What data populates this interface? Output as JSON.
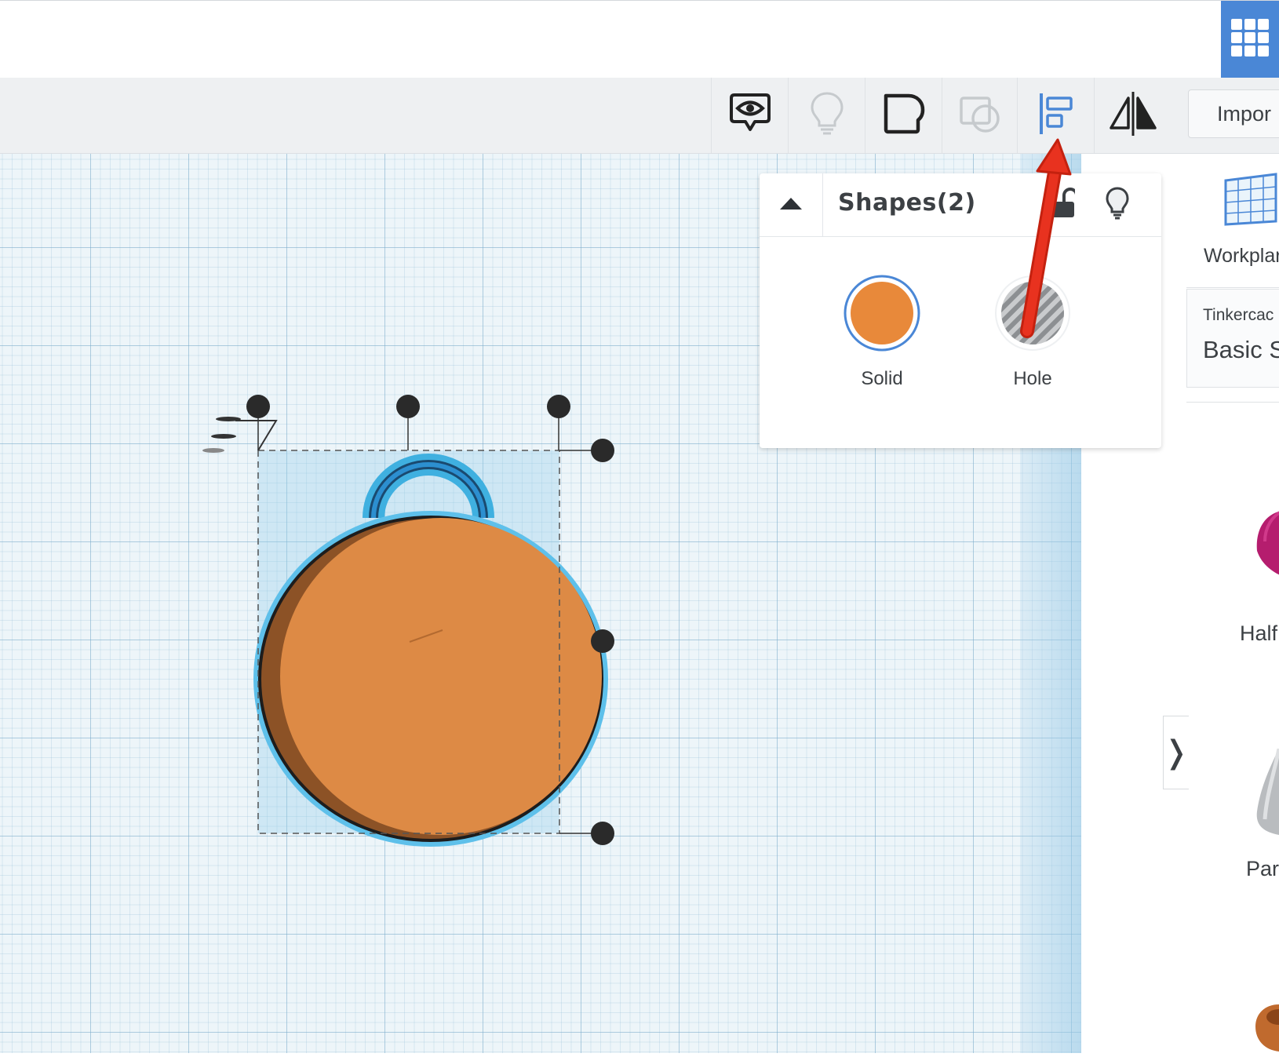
{
  "header": {
    "grid_view_icon": "grid-icon"
  },
  "toolbar": {
    "tools": [
      {
        "name": "notes",
        "icon": "eye-bubble-icon"
      },
      {
        "name": "show-all",
        "icon": "lightbulb-icon"
      },
      {
        "name": "group",
        "icon": "group-shape-icon"
      },
      {
        "name": "ungroup",
        "icon": "ungroup-shape-icon"
      },
      {
        "name": "align",
        "icon": "align-icon"
      },
      {
        "name": "mirror",
        "icon": "mirror-icon"
      }
    ],
    "import_label": "Impor"
  },
  "inspector": {
    "title": "Shapes(2)",
    "solid_label": "Solid",
    "hole_label": "Hole",
    "solid_color": "#e8893a"
  },
  "sidebar": {
    "workplane_label": "Workplar",
    "library_source": "Tinkercac",
    "library_name": "Basic S",
    "shape_labels": [
      "Half",
      "Para"
    ]
  },
  "annotation": {
    "arrow_color": "#e8321f",
    "target": "align-icon"
  },
  "colors": {
    "accent": "#4a87d6",
    "shape_orange": "#dd8a45",
    "selection_blue": "#3fb0e0"
  }
}
